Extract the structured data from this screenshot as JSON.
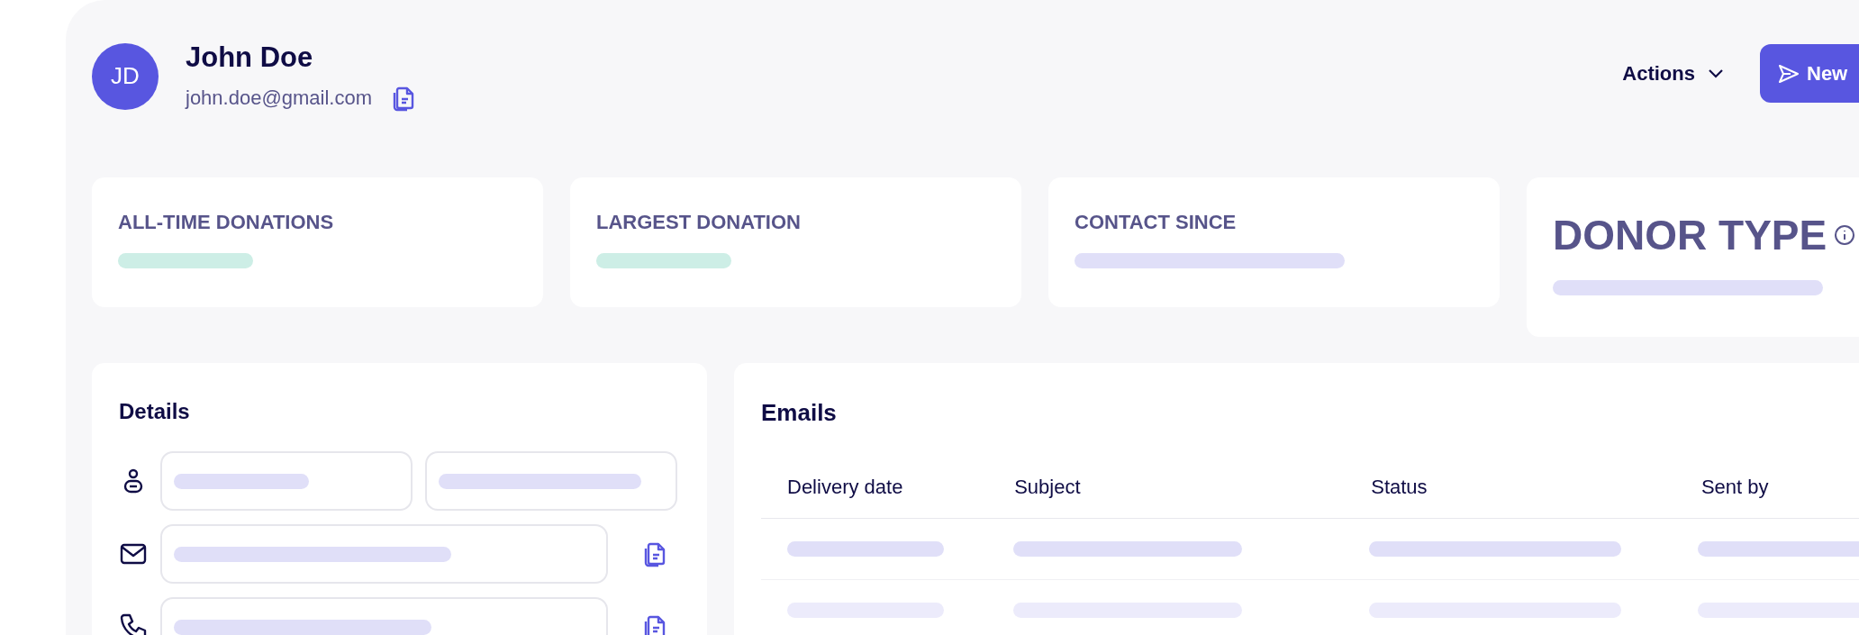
{
  "contact": {
    "initials": "JD",
    "name": "John Doe",
    "email": "john.doe@gmail.com"
  },
  "header_actions": {
    "actions_label": "Actions",
    "new_label": "New"
  },
  "stat_cards": [
    {
      "title": "ALL-TIME DONATIONS",
      "kind": "money"
    },
    {
      "title": "LARGEST DONATION",
      "kind": "money"
    },
    {
      "title": "CONTACT SINCE",
      "kind": "date"
    },
    {
      "title": "DONOR TYPE",
      "kind": "featured"
    }
  ],
  "details": {
    "title": "Details"
  },
  "emails": {
    "title": "Emails",
    "columns": [
      "Delivery date",
      "Subject",
      "Status",
      "Sent by"
    ]
  }
}
